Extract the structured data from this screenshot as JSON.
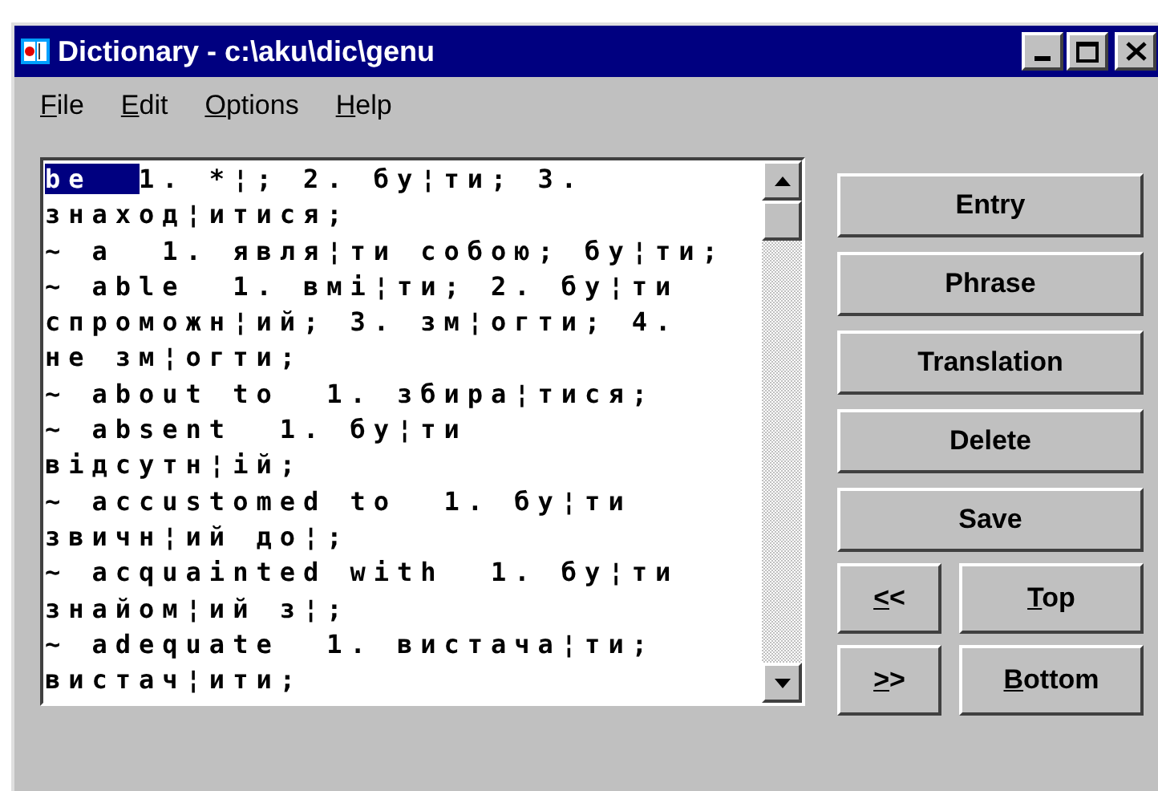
{
  "window": {
    "title": "Dictionary - c:\\aku\\dic\\genu"
  },
  "menu": [
    {
      "key": "F",
      "rest": "ile"
    },
    {
      "key": "E",
      "rest": "dit"
    },
    {
      "key": "O",
      "rest": "ptions"
    },
    {
      "key": "H",
      "rest": "elp"
    }
  ],
  "editor": {
    "lines": [
      {
        "selected_text": "be  ",
        "text": "1. *¦; 2. бу¦ти; 3."
      },
      {
        "text": "знаход¦итися;"
      },
      {
        "text": "~ a  1. явля¦ти собою; бу¦ти;"
      },
      {
        "text": "~ able  1. вмі¦ти; 2. бу¦ти"
      },
      {
        "text": "спроможн¦ий; 3. зм¦огти; 4."
      },
      {
        "text": "не зм¦огти;"
      },
      {
        "text": "~ about to  1. збира¦тися;"
      },
      {
        "text": "~ absent  1. бу¦ти"
      },
      {
        "text": "відсутн¦ій;"
      },
      {
        "text": "~ accustomed to  1. бу¦ти"
      },
      {
        "text": "звичн¦ий до¦;"
      },
      {
        "text": "~ acquainted with  1. бу¦ти"
      },
      {
        "text": "знайом¦ий з¦;"
      },
      {
        "text": "~ adequate  1. вистача¦ти;"
      },
      {
        "text": "вистач¦ити;"
      }
    ]
  },
  "buttons": [
    {
      "kind": "wide",
      "label": "Entry"
    },
    {
      "kind": "wide",
      "label": "Phrase"
    },
    {
      "kind": "wide",
      "label": "Translation"
    },
    {
      "kind": "wide",
      "label": "Delete"
    },
    {
      "kind": "wide",
      "label": "Save"
    }
  ],
  "nav_rows": [
    [
      {
        "key": "<",
        "rest": "<"
      },
      {
        "key": "T",
        "rest": "op"
      }
    ],
    [
      {
        "key": ">",
        "rest": ">"
      },
      {
        "key": "B",
        "rest": "ottom"
      }
    ]
  ]
}
